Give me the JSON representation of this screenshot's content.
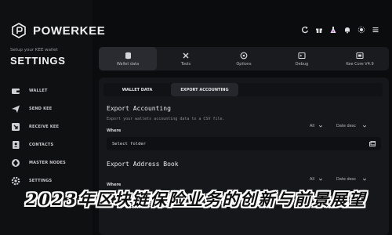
{
  "brand": {
    "name": "POWERKEE"
  },
  "sidebar": {
    "subtitle": "Setup your KEE wallet",
    "title": "SETTINGS",
    "items": [
      {
        "label": "WALLET",
        "icon": "wallet-icon"
      },
      {
        "label": "SEND KEE",
        "icon": "send-icon"
      },
      {
        "label": "RECEIVE KEE",
        "icon": "receive-icon"
      },
      {
        "label": "CONTACTS",
        "icon": "contacts-icon"
      },
      {
        "label": "MASTER NODES",
        "icon": "master-nodes-icon"
      },
      {
        "label": "SETTINGS",
        "icon": "settings-icon"
      }
    ]
  },
  "top_controls": [
    "refresh-icon",
    "gift-icon",
    "flask-icon",
    "bell-icon",
    "sun-icon",
    "menu-icon"
  ],
  "tabs": [
    {
      "label": "Wallet data",
      "icon": "database-icon",
      "active": true
    },
    {
      "label": "Tools",
      "icon": "tools-icon",
      "active": false
    },
    {
      "label": "Options",
      "icon": "options-icon",
      "active": false
    },
    {
      "label": "Debug",
      "icon": "debug-icon",
      "active": false
    },
    {
      "label": "Kee Core V4.9",
      "icon": "core-icon",
      "active": false
    }
  ],
  "subtabs": [
    {
      "label": "WALLET DATA",
      "active": false
    },
    {
      "label": "EXPORT ACCOUNTING",
      "active": true
    }
  ],
  "export_accounting": {
    "title": "Export Accounting",
    "description": "Export your wallets accounting data to a CSV file.",
    "where_label": "Where",
    "filter_all": "All",
    "sort": "Date desc",
    "folder_placeholder": "Select folder"
  },
  "export_address_book": {
    "title": "Export Address Book",
    "where_label": "Where",
    "filter_all": "All",
    "sort": "Date desc"
  },
  "overlay_banner": "2023年区块链保险业务的创新与前景展望",
  "colors": {
    "background": "#0b0c0e",
    "panel": "#16171a",
    "accent": "#ffffff"
  }
}
